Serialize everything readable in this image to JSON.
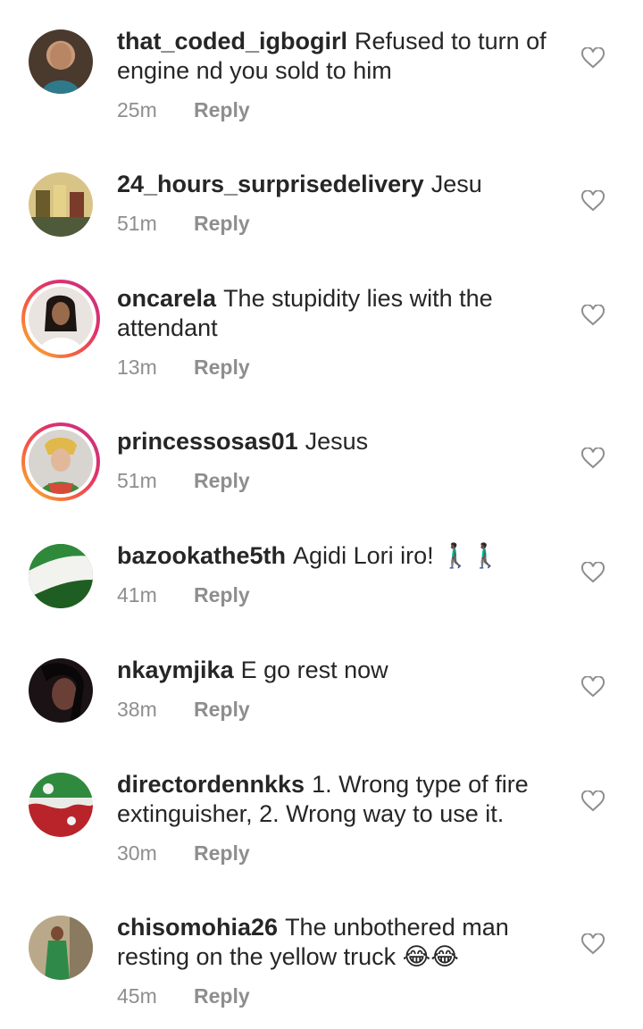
{
  "comments": [
    {
      "username": "that_coded_igbogirl",
      "text": "Refused to turn of engine nd you sold to him",
      "time": "25m",
      "reply": "Reply",
      "avatar": "woman-portrait",
      "story_ring": false
    },
    {
      "username": "24_hours_surprisedelivery",
      "text": "Jesu",
      "time": "51m",
      "reply": "Reply",
      "avatar": "gift-items",
      "story_ring": false
    },
    {
      "username": "oncarela",
      "text": "The stupidity lies with the attendant",
      "time": "13m",
      "reply": "Reply",
      "avatar": "woman-white-outfit",
      "story_ring": true
    },
    {
      "username": "princessosas01",
      "text": "Jesus",
      "time": "51m",
      "reply": "Reply",
      "avatar": "woman-headwrap",
      "story_ring": true
    },
    {
      "username": "bazookathe5th",
      "text": "Agidi Lori iro! 🚶🏿‍♂️🚶🏿‍♂️",
      "time": "41m",
      "reply": "Reply",
      "avatar": "green-white-flag",
      "story_ring": false
    },
    {
      "username": "nkaymjika",
      "text": "E go rest now",
      "time": "38m",
      "reply": "Reply",
      "avatar": "woman-dark-photo",
      "story_ring": false
    },
    {
      "username": "directordennkks",
      "text": "1. Wrong type of fire extinguisher,  2. Wrong way to use it.",
      "time": "30m",
      "reply": "Reply",
      "avatar": "red-green-graphic",
      "story_ring": false
    },
    {
      "username": "chisomohia26",
      "text": "The unbothered man resting on the yellow truck 😂😂",
      "time": "45m",
      "reply": "Reply",
      "avatar": "woman-green-outfit",
      "story_ring": false
    }
  ],
  "colors": {
    "text": "#262626",
    "secondary": "#8e8e8e",
    "ring_start": "#f9c02e",
    "ring_end": "#c13584"
  },
  "icons": {
    "like": "heart-outline-icon"
  }
}
